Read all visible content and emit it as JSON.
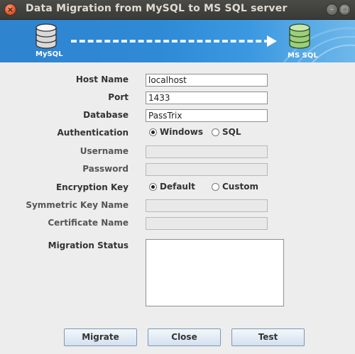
{
  "window": {
    "title": "Data Migration from MySQL to MS SQL server"
  },
  "banner": {
    "source_label": "MySQL",
    "target_label": "MS SQL"
  },
  "form": {
    "host_label": "Host Name",
    "host_value": "localhost",
    "port_label": "Port",
    "port_value": "1433",
    "database_label": "Database",
    "database_value": "PassTrix",
    "auth_label": "Authentication",
    "auth_windows": "Windows",
    "auth_sql": "SQL",
    "auth_selected": "Windows",
    "username_label": "Username",
    "username_value": "",
    "password_label": "Password",
    "password_value": "",
    "enc_label": "Encryption Key",
    "enc_default": "Default",
    "enc_custom": "Custom",
    "enc_selected": "Default",
    "symkey_label": "Symmetric Key Name",
    "symkey_value": "",
    "cert_label": "Certificate Name",
    "cert_value": "",
    "status_label": "Migration Status",
    "status_value": ""
  },
  "buttons": {
    "migrate": "Migrate",
    "close": "Close",
    "test": "Test"
  },
  "colors": {
    "banner": "#2f83cf",
    "titlebar": "#3c3b37",
    "close_button": "#e0562b"
  }
}
